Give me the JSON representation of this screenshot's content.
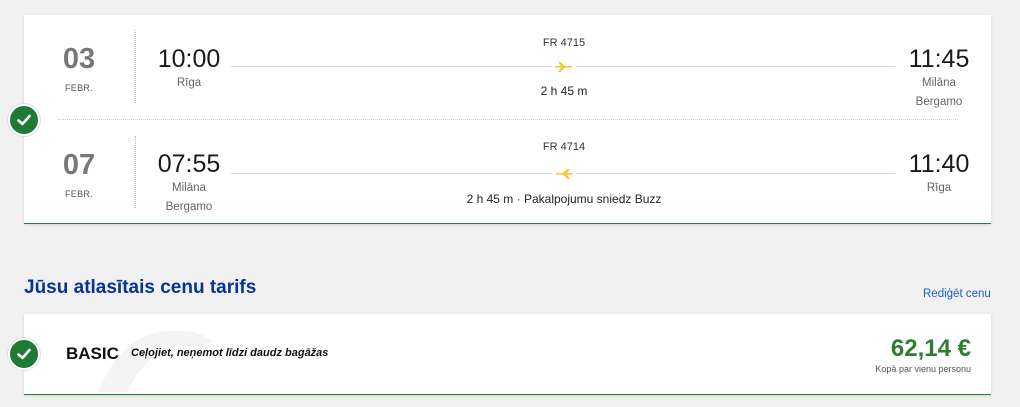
{
  "flights": [
    {
      "date_day": "03",
      "date_month": "FEBR.",
      "dep_time": "10:00",
      "dep_city_line1": "Rīga",
      "dep_city_line2": "",
      "flight_no": "FR 4715",
      "duration": "2 h 45 m",
      "arr_time": "11:45",
      "arr_city_line1": "Milāna",
      "arr_city_line2": "Bergamo"
    },
    {
      "date_day": "07",
      "date_month": "FEBR.",
      "dep_time": "07:55",
      "dep_city_line1": "Milāna",
      "dep_city_line2": "Bergamo",
      "flight_no": "FR 4714",
      "duration": "2 h 45 m · Pakalpojumu sniedz Buzz",
      "arr_time": "11:40",
      "arr_city_line1": "Rīga",
      "arr_city_line2": ""
    }
  ],
  "fare_section": {
    "title": "Jūsu atlasītais cenu tarifs",
    "edit_link": "Rediģēt cenu",
    "fare_name": "BASIC",
    "fare_description": "Ceļojiet, neņemot līdzi daudz bagāžas",
    "price": "62,14 €",
    "price_note": "Kopā par vienu personu"
  },
  "icons": {
    "check": "check-icon",
    "plane": "plane-icon"
  },
  "colors": {
    "accent_green": "#2e7d32",
    "check_green": "#1f7a33",
    "title_blue": "#073590",
    "link_blue": "#1e5fc2",
    "plane_yellow": "#f1c933"
  }
}
